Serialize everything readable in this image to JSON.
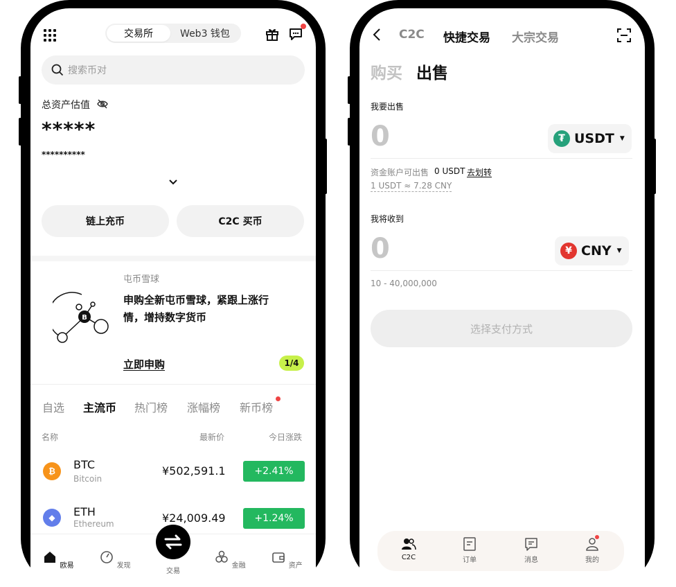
{
  "left": {
    "segment": {
      "exchange": "交易所",
      "web3": "Web3 钱包"
    },
    "search": {
      "placeholder": "搜索币对"
    },
    "assets": {
      "label": "总资产估值",
      "value": "*****",
      "sub_value": "**********"
    },
    "actions": {
      "onchain_deposit": "链上充币",
      "c2c_buy": "C2C 买币"
    },
    "banner": {
      "tag": "屯币雪球",
      "line1": "申购全新屯币雪球，紧跟上涨行",
      "line2": "情，增持数字货币",
      "cta": "立即申购",
      "page": "1/4"
    },
    "tabs": [
      "自选",
      "主流币",
      "热门榜",
      "涨幅榜",
      "新币榜"
    ],
    "table_header": {
      "name": "名称",
      "price": "最新价",
      "change": "今日涨跌"
    },
    "rows": [
      {
        "symbol": "BTC",
        "name": "Bitcoin",
        "price": "¥502,591.1",
        "change": "+2.41%",
        "color": "#f7931a"
      },
      {
        "symbol": "ETH",
        "name": "Ethereum",
        "price": "¥24,009.49",
        "change": "+1.24%",
        "color": "#627eea"
      }
    ],
    "nav": [
      "欧易",
      "发现",
      "交易",
      "金融",
      "资产"
    ],
    "colors": {
      "positive": "#23b85f",
      "accent": "#c7f04a",
      "dot": "#ef4444"
    }
  },
  "right": {
    "tabs": [
      "C2C",
      "快捷交易",
      "大宗交易"
    ],
    "subtabs": {
      "buy": "购买",
      "sell": "出售"
    },
    "sell": {
      "label": "我要出售",
      "amount": "0",
      "currency": "USDT",
      "avail_label": "资金账户可出售",
      "avail_value": "0 USDT",
      "transfer": "去划转",
      "rate": "1 USDT ≈ 7.28 CNY"
    },
    "receive": {
      "label": "我将收到",
      "amount": "0",
      "currency": "CNY",
      "range": "10 - 40,000,000"
    },
    "pay_button": "选择支付方式",
    "nav": [
      "C2C",
      "订单",
      "消息",
      "我的"
    ],
    "colors": {
      "usdt": "#26a17b",
      "cny": "#e2362f"
    }
  }
}
